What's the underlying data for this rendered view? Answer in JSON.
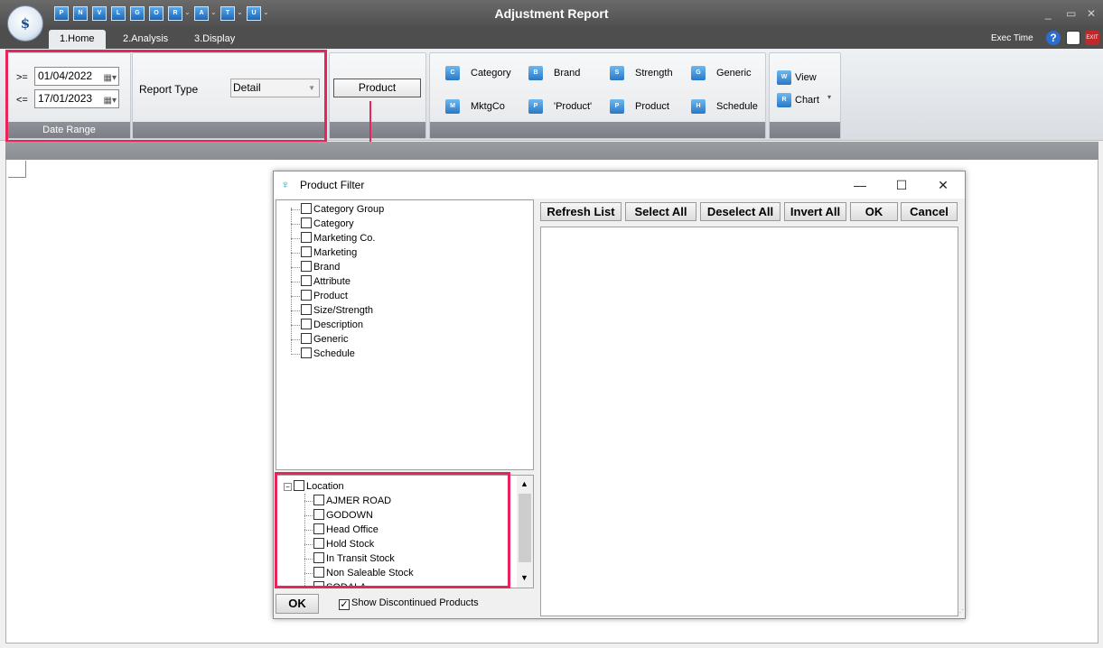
{
  "app": {
    "title": "Adjustment Report",
    "quick_access": [
      "P",
      "N",
      "V",
      "L",
      "G",
      "O",
      "R",
      "A",
      "T",
      "U"
    ]
  },
  "tabs": [
    {
      "label": "1.Home",
      "active": true
    },
    {
      "label": "2.Analysis",
      "active": false
    },
    {
      "label": "3.Display",
      "active": false
    }
  ],
  "topbar": {
    "exec_time": "Exec Time"
  },
  "ribbon": {
    "date_range": {
      "from_op": ">=",
      "from_value": "01/04/2022",
      "to_op": "<=",
      "to_value": "17/01/2023",
      "group_label": "Date Range"
    },
    "report_type": {
      "label": "Report Type",
      "value": "Detail"
    },
    "product_button": "Product",
    "filters": [
      {
        "label": "Category",
        "icon": "C"
      },
      {
        "label": "Brand",
        "icon": "B"
      },
      {
        "label": "Strength",
        "icon": "S"
      },
      {
        "label": "Generic",
        "icon": "G"
      },
      {
        "label": "MktgCo",
        "icon": "M"
      },
      {
        "label": "'Product'",
        "icon": "P"
      },
      {
        "label": "Product",
        "icon": "P"
      },
      {
        "label": "Schedule",
        "icon": "H"
      }
    ],
    "view": {
      "view_label": "View",
      "chart_label": "Chart"
    }
  },
  "dialog": {
    "title": "Product Filter",
    "tree_items": [
      "Category Group",
      "Category",
      "Marketing Co.",
      "Marketing",
      "Brand",
      "Attribute",
      "Product",
      "Size/Strength",
      "Description",
      "Generic",
      "Schedule"
    ],
    "location": {
      "label": "Location",
      "items": [
        "AJMER ROAD",
        "GODOWN",
        "Head Office",
        "Hold Stock",
        "In Transit Stock",
        "Non Saleable Stock",
        "SODALA"
      ]
    },
    "buttons": {
      "refresh": "Refresh List",
      "select_all": "Select All",
      "deselect_all": "Deselect All",
      "invert_all": "Invert All",
      "ok": "OK",
      "cancel": "Cancel"
    },
    "footer": {
      "ok": "OK",
      "show_discontinued": "Show Discontinued Products",
      "show_discontinued_checked": true
    }
  },
  "colors": {
    "highlight": "#e8245a",
    "ribbon_label": "#7b7f85",
    "titlebar": "#4e4e4e"
  }
}
